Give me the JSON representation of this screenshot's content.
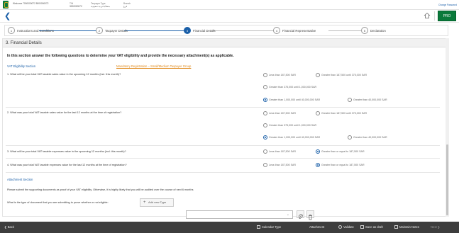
{
  "header": {
    "fields": [
      {
        "label": "",
        "value": "Welcome 7000000072 8000000072"
      },
      {
        "label": "TIN",
        "value": "3000000072"
      },
      {
        "label": "Taxpayer Type",
        "value": "منشأة فردية سعودية"
      },
      {
        "label": "Branch",
        "value": "فرع"
      }
    ],
    "change_password": "Change Password"
  },
  "toolbar": {
    "back_glyph": "❮",
    "pro_label": "PRO"
  },
  "steps": [
    {
      "num": "1",
      "label": "Instructions and Conditions",
      "state": "done"
    },
    {
      "num": "2",
      "label": "Taxpayer Details",
      "state": "done"
    },
    {
      "num": "3",
      "label": "Financial Details",
      "state": "active"
    },
    {
      "num": "4",
      "label": "Financial Representative",
      "state": "todo"
    },
    {
      "num": "5",
      "label": "Declaration",
      "state": "todo"
    }
  ],
  "section": {
    "title": "3. Financial Details",
    "intro": "In this section answer the following questions to determine your VAT eligibility and provide the necessary attachment(s) as applicable.",
    "eligibility_label": "VAT Eligibility Section",
    "eligibility_status": "Mandatory Registration – Small/Medium Taxpayer Group"
  },
  "questions": [
    {
      "text": "1. What will be your total VAT taxable sales value in the upcoming 12 months (incl. this month)?",
      "options": [
        "Less than 187,500 SAR",
        "Greater than 187,500 until 375,000 SAR",
        "Greater than 375,000 until 1,000,000 SAR",
        "Greater than 1,000,000 until 40,000,000 SAR",
        "Greater than 40,000,000 SAR"
      ],
      "selected": 3
    },
    {
      "text": "2. What was your total VAT taxable sales value for the last 12 months at the time of registration?",
      "options": [
        "Less than 187,500 SAR",
        "Greater than 187,500 until 375,000 SAR",
        "Greater than 375,000 until 1,000,000 SAR",
        "Greater than 1,000,000 until 40,000,000 SAR",
        "Greater than 40,000,000 SAR"
      ],
      "selected": 3
    },
    {
      "text": "3. What will be your total VAT taxable expenses value in the upcoming 12 months (incl. this month)?",
      "options": [
        "Less than 187,500 SAR",
        "Greater than or equal to 187,500 SAR"
      ],
      "selected": 1
    },
    {
      "text": "4. What was your total VAT taxable expenses value for the last 12 months at the time of registration?",
      "options": [
        "Less than 187,500 SAR",
        "Greater than or equal to 187,500 SAR"
      ],
      "selected": 1
    }
  ],
  "attachment": {
    "label": "Attachment Section",
    "instruction": "Please submit the supporting documents as proof of your VAT eligibility. Otherwise, it is highly likely that you will be audited over the course of next 6 months",
    "doc_question": "What is the type of document that you are submitting to prove whether or not eligible:",
    "add_type_label": "Add new Type",
    "dropdown_value": ""
  },
  "footer": {
    "back": "Back",
    "calendar_type": "Calendar Type",
    "attachment": "Attachment",
    "validate": "Validate",
    "save_draft": "Save as draft",
    "maintain_notes": "Maintain Notes",
    "next": "Next"
  },
  "colors": {
    "brand_green": "#0a7a3b",
    "link_blue": "#1a5fa8",
    "status_orange": "#e08a1c",
    "footer_bg": "#3d3d3d"
  }
}
